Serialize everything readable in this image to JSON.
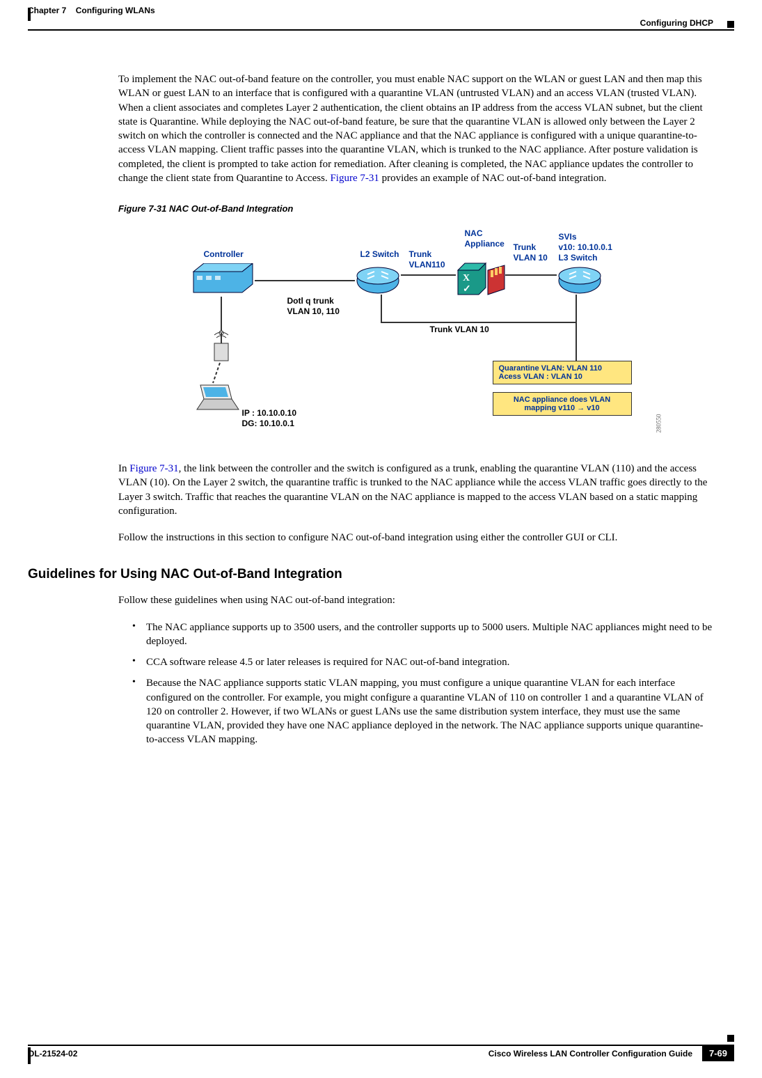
{
  "header": {
    "chapter": "Chapter 7",
    "title": "Configuring WLANs",
    "section": "Configuring DHCP"
  },
  "body": {
    "p1_a": "To implement the NAC out-of-band feature on the controller, you must enable NAC support on the WLAN or guest LAN and then map this WLAN or guest LAN to an interface that is configured with a quarantine VLAN (untrusted VLAN) and an access VLAN (trusted VLAN). When a client associates and completes Layer 2 authentication, the client obtains an IP address from the access VLAN subnet, but the client state is Quarantine. While deploying the NAC out-of-band feature, be sure that the quarantine VLAN is allowed only between the Layer 2 switch on which the controller is connected and the NAC appliance and that the NAC appliance is configured with a unique quarantine-to-access VLAN mapping. Client traffic passes into the quarantine VLAN, which is trunked to the NAC appliance. After posture validation is completed, the client is prompted to take action for remediation. After cleaning is completed, the NAC appliance updates the controller to change the client state from Quarantine to Access. ",
    "p1_link": "Figure 7-31",
    "p1_b": " provides an example of NAC out-of-band integration.",
    "figure_caption": "Figure 7-31   NAC Out-of-Band Integration",
    "p2_a": "In ",
    "p2_link": "Figure 7-31",
    "p2_b": ", the link between the controller and the switch is configured as a trunk, enabling the quarantine VLAN (110) and the access VLAN (10). On the Layer 2 switch, the quarantine traffic is trunked to the NAC appliance while the access VLAN traffic goes directly to the Layer 3 switch. Traffic that reaches the quarantine VLAN on the NAC appliance is mapped to the access VLAN based on a static mapping configuration.",
    "p3": "Follow the instructions in this section to configure NAC out-of-band integration using either the controller GUI or CLI."
  },
  "section": {
    "heading": "Guidelines for Using NAC Out-of-Band Integration",
    "intro": "Follow these guidelines when using NAC out-of-band integration:",
    "bullets": {
      "b0": "The NAC appliance supports up to 3500 users, and the controller supports up to 5000 users. Multiple NAC appliances might need to be deployed.",
      "b1": "CCA software release 4.5 or later releases is required for NAC out-of-band integration.",
      "b2": "Because the NAC appliance supports static VLAN mapping, you must configure a unique quarantine VLAN for each interface configured on the controller. For example, you might configure a quarantine VLAN of 110 on controller 1 and a quarantine VLAN of 120 on controller 2. However, if two WLANs or guest LANs use the same distribution system interface, they must use the same quarantine VLAN, provided they have one NAC appliance deployed in the network. The NAC appliance supports unique quarantine-to-access VLAN mapping."
    }
  },
  "figure": {
    "controller": "Controller",
    "l2switch": "L2 Switch",
    "trunk110": "Trunk",
    "trunk110b": "VLAN110",
    "nac": "NAC",
    "nacb": "Appliance",
    "trunk10": "Trunk",
    "trunk10b": "VLAN 10",
    "svis": "SVIs",
    "svisb": "v10: 10.10.0.1",
    "l3switch": "L3 Switch",
    "dot1q": "Dotl q trunk",
    "dot1qb": "VLAN 10, 110",
    "trunk_vlan10": "Trunk VLAN 10",
    "ip": "IP  : 10.10.0.10",
    "dg": "DG: 10.10.0.1",
    "box1a": "Quarantine VLAN: VLAN 110",
    "box1b": "Acess VLAN         : VLAN 10",
    "box2a": "NAC appliance does VLAN",
    "box2b": "mapping v110 → v10",
    "watermark": "280550"
  },
  "footer": {
    "guide": "Cisco Wireless LAN Controller Configuration Guide",
    "doc": "OL-21524-02",
    "page": "7-69"
  }
}
